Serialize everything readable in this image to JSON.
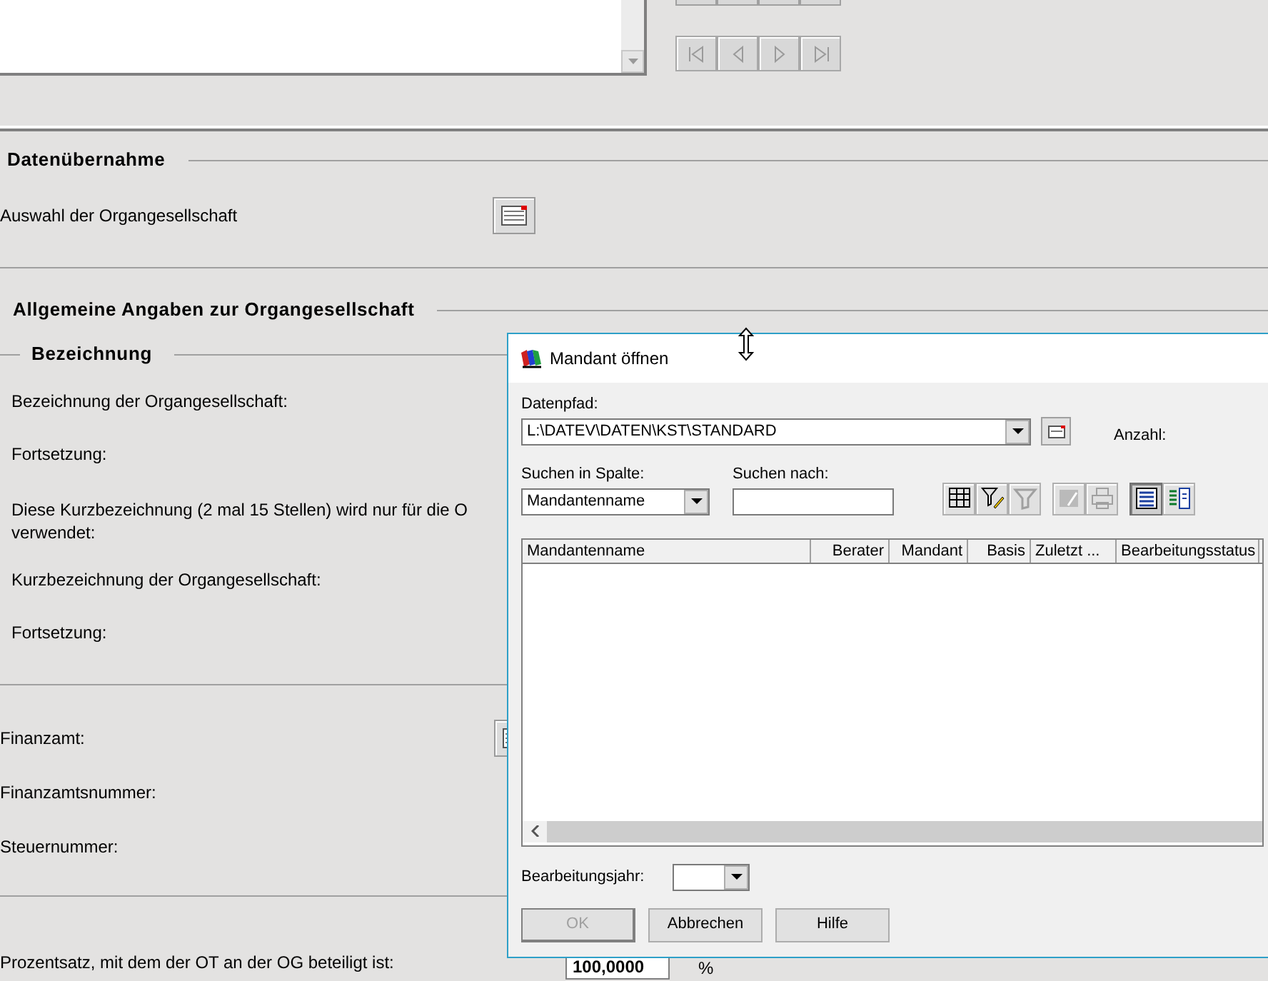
{
  "nav_buttons": [
    {
      "kind": "first",
      "disabled": true
    },
    {
      "kind": "prev",
      "disabled": true
    },
    {
      "kind": "next",
      "disabled": true
    },
    {
      "kind": "last",
      "disabled": true
    }
  ],
  "sections": {
    "datenuebernahme": {
      "title": "Datenübernahme",
      "label": "Auswahl der Organgesellschaft"
    },
    "allgemein": {
      "title": "Allgemeine Angaben zur Organgesellschaft",
      "subtitle": "Bezeichnung",
      "labels": [
        "Bezeichnung der Organgesellschaft:",
        "Fortsetzung:",
        "Diese Kurzbezeichnung (2 mal 15 Stellen) wird nur für die O\nverwendet:",
        "Kurzbezeichnung der Organgesellschaft:",
        "Fortsetzung:"
      ]
    },
    "finanzamt": {
      "labels": [
        "Finanzamt:",
        "Finanzamtsnummer:",
        "Steuernummer:"
      ]
    },
    "beteiligung": {
      "label": "Prozentsatz, mit dem der OT an der OG beteiligt ist:",
      "value": "100,0000",
      "unit": "%"
    }
  },
  "dialog": {
    "title": "Mandant öffnen",
    "datenpfad_label": "Datenpfad:",
    "datenpfad": "L:\\DATEV\\DATEN\\KST\\STANDARD",
    "anzahl_label": "Anzahl:",
    "suchen_in_label": "Suchen in Spalte:",
    "suchen_in": "Mandantenname",
    "suchen_nach_label": "Suchen nach:",
    "toolbar": [
      {
        "kind": "grid-search",
        "disabled": false,
        "selected": false
      },
      {
        "kind": "filter-edit",
        "disabled": false,
        "selected": false
      },
      {
        "kind": "filter",
        "disabled": true,
        "selected": false
      },
      {
        "kind": "edit",
        "disabled": true,
        "selected": false
      },
      {
        "kind": "print",
        "disabled": true,
        "selected": false
      },
      {
        "kind": "list-view",
        "disabled": false,
        "selected": true
      },
      {
        "kind": "detail-view",
        "disabled": false,
        "selected": false
      }
    ],
    "table": {
      "columns": [
        {
          "label": "Mandantenname"
        },
        {
          "label": "Berater"
        },
        {
          "label": "Mandant"
        },
        {
          "label": "Basis"
        },
        {
          "label": "Zuletzt ..."
        },
        {
          "label": "Bearbeitungsstatus"
        }
      ]
    },
    "jahr_label": "Bearbeitungsjahr:",
    "buttons": [
      {
        "label": "OK",
        "disabled": true
      },
      {
        "label": "Abbrechen",
        "disabled": false
      },
      {
        "label": "Hilfe",
        "disabled": false
      }
    ]
  }
}
